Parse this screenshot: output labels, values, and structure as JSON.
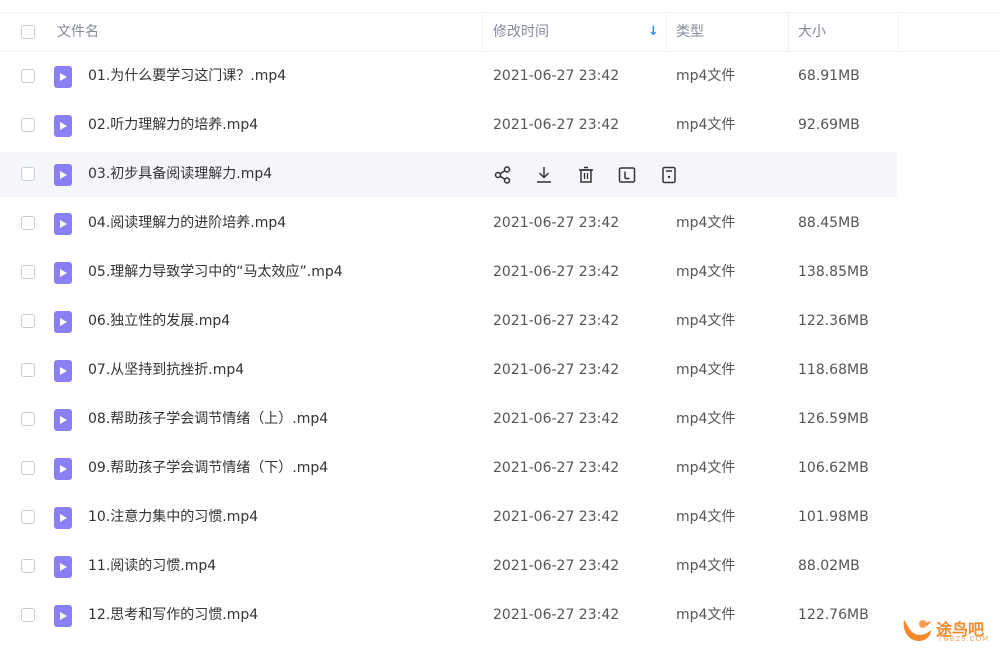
{
  "header": {
    "name": "文件名",
    "modified": "修改时间",
    "type": "类型",
    "size": "大小",
    "sort_arrow": "↓"
  },
  "rows": [
    {
      "name": "01.为什么要学习这门课？.mp4",
      "time": "2021-06-27 23:42",
      "type": "mp4文件",
      "size": "68.91MB"
    },
    {
      "name": "02.听力理解力的培养.mp4",
      "time": "2021-06-27 23:42",
      "type": "mp4文件",
      "size": "92.69MB"
    },
    {
      "name": "03.初步具备阅读理解力.mp4",
      "time": "",
      "type": "",
      "size": ""
    },
    {
      "name": "04.阅读理解力的进阶培养.mp4",
      "time": "2021-06-27 23:42",
      "type": "mp4文件",
      "size": "88.45MB"
    },
    {
      "name": "05.理解力导致学习中的“马太效应”.mp4",
      "time": "2021-06-27 23:42",
      "type": "mp4文件",
      "size": "138.85MB"
    },
    {
      "name": "06.独立性的发展.mp4",
      "time": "2021-06-27 23:42",
      "type": "mp4文件",
      "size": "122.36MB"
    },
    {
      "name": "07.从坚持到抗挫折.mp4",
      "time": "2021-06-27 23:42",
      "type": "mp4文件",
      "size": "118.68MB"
    },
    {
      "name": "08.帮助孩子学会调节情绪（上）.mp4",
      "time": "2021-06-27 23:42",
      "type": "mp4文件",
      "size": "126.59MB"
    },
    {
      "name": "09.帮助孩子学会调节情绪（下）.mp4",
      "time": "2021-06-27 23:42",
      "type": "mp4文件",
      "size": "106.62MB"
    },
    {
      "name": "10.注意力集中的习惯.mp4",
      "time": "2021-06-27 23:42",
      "type": "mp4文件",
      "size": "101.98MB"
    },
    {
      "name": "11.阅读的习惯.mp4",
      "time": "2021-06-27 23:42",
      "type": "mp4文件",
      "size": "88.02MB"
    },
    {
      "name": "12.思考和写作的习惯.mp4",
      "time": "2021-06-27 23:42",
      "type": "mp4文件",
      "size": "122.76MB"
    }
  ],
  "hover_actions": [
    "share-icon",
    "download-icon",
    "delete-icon",
    "rename-icon",
    "more-icon"
  ],
  "watermark": {
    "text": "途鸟吧",
    "sub": "TNBZS.COM"
  },
  "colors": {
    "file_icon": "#8a7ff5",
    "sort_arrow": "#2f8ff0",
    "hover_bg": "#f5f6fa",
    "watermark": "#f08a2a"
  }
}
